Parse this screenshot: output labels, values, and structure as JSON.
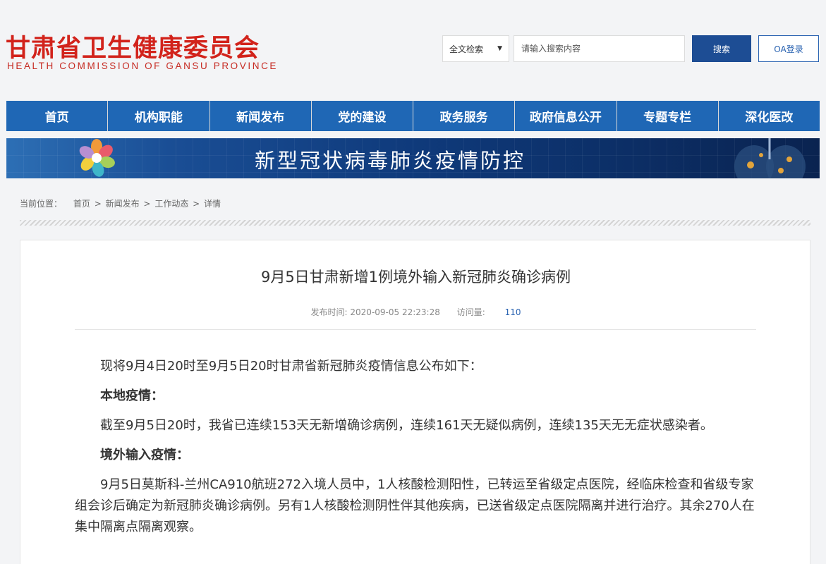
{
  "header": {
    "logo_cn": "甘肃省卫生健康委员会",
    "logo_en": "HEALTH COMMISSION OF GANSU PROVINCE",
    "search_scope": "全文检索",
    "search_placeholder": "请输入搜索内容",
    "search_button": "搜索",
    "oa_button": "OA登录"
  },
  "nav": [
    "首页",
    "机构职能",
    "新闻发布",
    "党的建设",
    "政务服务",
    "政府信息公开",
    "专题专栏",
    "深化医改"
  ],
  "banner": {
    "title": "新型冠状病毒肺炎疫情防控"
  },
  "breadcrumb": {
    "label": "当前位置：",
    "items": [
      "首页",
      "新闻发布",
      "工作动态",
      "详情"
    ],
    "separator": ">"
  },
  "article": {
    "title": "9月5日甘肃新增1例境外输入新冠肺炎确诊病例",
    "publish_label": "发布时间:",
    "publish_time": "2020-09-05 22:23:28",
    "views_label": "访问量:",
    "views": "110",
    "paragraphs": [
      "现将9月4日20时至9月5日20时甘肃省新冠肺炎疫情信息公布如下：",
      "本地疫情：",
      "截至9月5日20时，我省已连续153天无新增确诊病例，连续161天无疑似病例，连续135天无无症状感染者。",
      "境外输入疫情：",
      "9月5日莫斯科-兰州CA910航班272入境人员中，1人核酸检测阳性，已转运至省级定点医院，经临床检查和省级专家组会诊后确定为新冠肺炎确诊病例。另有1人核酸检测阴性伴其他疾病，已送省级定点医院隔离并进行治疗。其余270人在集中隔离点隔离观察。"
    ]
  },
  "colors": {
    "brand_red": "#d2231b",
    "nav_blue": "#1f67b5",
    "button_blue": "#1d4d94"
  }
}
